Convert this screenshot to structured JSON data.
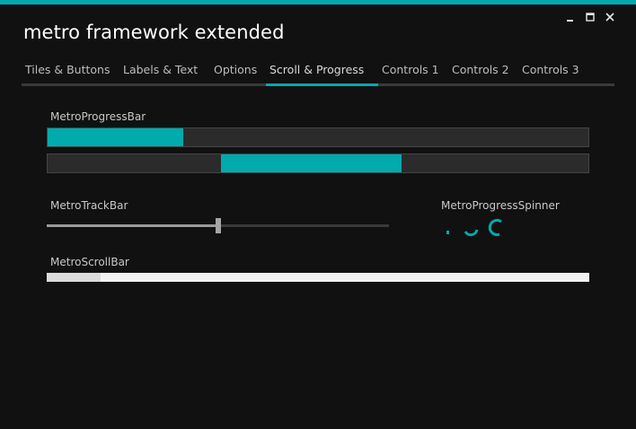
{
  "window": {
    "title": "metro framework extended",
    "accent_color": "#00aaad",
    "controls": {
      "minimize_icon": "minimize-icon",
      "maximize_icon": "maximize-icon",
      "close_icon": "close-icon"
    }
  },
  "tabs": [
    {
      "label": "Tiles & Buttons",
      "active": false
    },
    {
      "label": "Labels & Text",
      "active": false
    },
    {
      "label": "Options",
      "active": false
    },
    {
      "label": "Scroll & Progress",
      "active": true
    },
    {
      "label": "Controls 1",
      "active": false
    },
    {
      "label": "Controls 2",
      "active": false
    },
    {
      "label": "Controls 3",
      "active": false
    }
  ],
  "progress": {
    "label": "MetroProgressBar",
    "bar1": {
      "start_fraction": 0.0,
      "end_fraction": 0.25
    },
    "bar2": {
      "start_fraction": 0.32,
      "end_fraction": 0.655
    }
  },
  "trackbar": {
    "label": "MetroTrackBar",
    "value_fraction": 0.5
  },
  "spinner": {
    "label": "MetroProgressSpinner"
  },
  "scrollbar": {
    "label": "MetroScrollBar"
  }
}
